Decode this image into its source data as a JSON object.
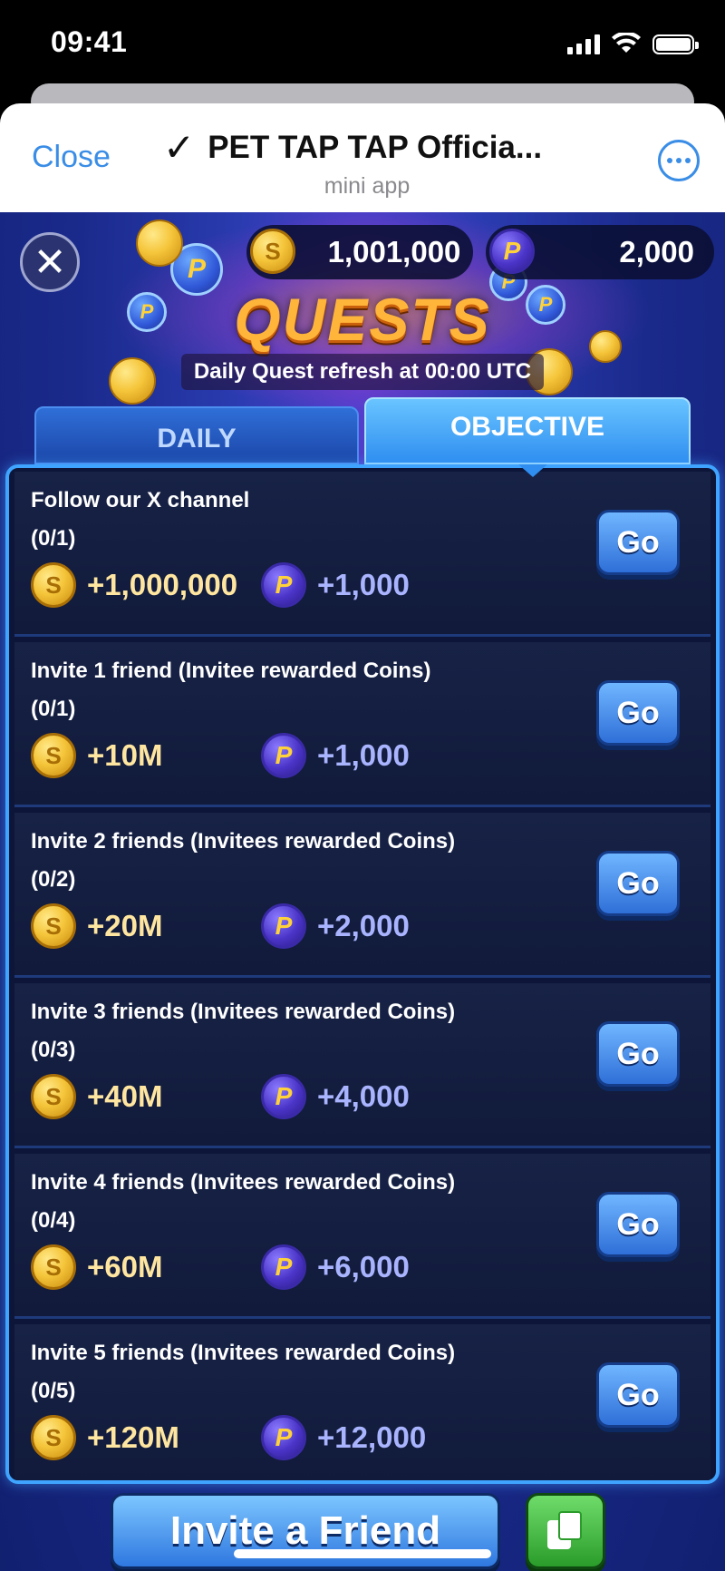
{
  "status_bar": {
    "time": "09:41"
  },
  "header": {
    "close_label": "Close",
    "verified_mark": "✓",
    "title": "PET TAP TAP Officia...",
    "subtitle": "mini app"
  },
  "game": {
    "close_glyph": "✕",
    "coin_balance": "1,001,000",
    "gem_balance": "2,000",
    "coin_symbol": "S",
    "gem_symbol": "P",
    "title": "QUESTS",
    "refresh_text": "Daily Quest refresh at 00:00 UTC",
    "tabs": [
      {
        "label": "DAILY",
        "active": false
      },
      {
        "label": "OBJECTIVE",
        "active": true
      }
    ],
    "quests": [
      {
        "name": "Follow our X channel",
        "progress": "(0/1)",
        "coin_reward": "+1,000,000",
        "gem_reward": "+1,000",
        "button": "Go"
      },
      {
        "name": "Invite 1 friend (Invitee rewarded Coins)",
        "progress": "(0/1)",
        "coin_reward": "+10M",
        "gem_reward": "+1,000",
        "button": "Go"
      },
      {
        "name": "Invite 2 friends (Invitees rewarded Coins)",
        "progress": "(0/2)",
        "coin_reward": "+20M",
        "gem_reward": "+2,000",
        "button": "Go"
      },
      {
        "name": "Invite 3 friends (Invitees rewarded Coins)",
        "progress": "(0/3)",
        "coin_reward": "+40M",
        "gem_reward": "+4,000",
        "button": "Go"
      },
      {
        "name": "Invite 4 friends (Invitees rewarded Coins)",
        "progress": "(0/4)",
        "coin_reward": "+60M",
        "gem_reward": "+6,000",
        "button": "Go"
      },
      {
        "name": "Invite 5 friends (Invitees rewarded Coins)",
        "progress": "(0/5)",
        "coin_reward": "+120M",
        "gem_reward": "+12,000",
        "button": "Go"
      }
    ],
    "invite_label": "Invite a Friend"
  },
  "colors": {
    "accent": "#3a8de6",
    "panel_border": "#3fa4ff",
    "go_button": "#2f6fd8",
    "copy_button": "#2a9c2a"
  },
  "icons": {
    "coin": "gold-coin-icon",
    "gem": "purple-gem-icon",
    "copy": "copy-icon",
    "more": "more-icon",
    "close": "close-icon"
  }
}
